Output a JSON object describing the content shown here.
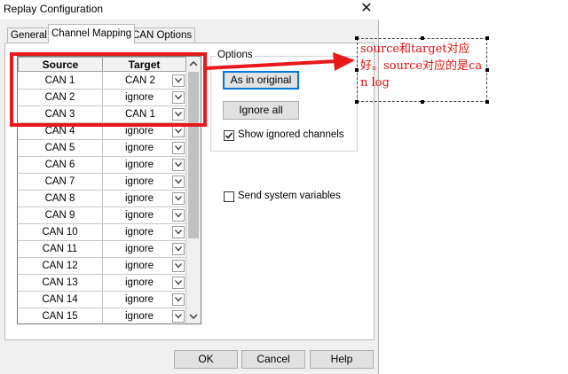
{
  "window": {
    "title": "Replay Configuration"
  },
  "tabs": [
    {
      "label": "General"
    },
    {
      "label": "Channel Mapping"
    },
    {
      "label": "CAN Options"
    }
  ],
  "grid": {
    "headers": {
      "source": "Source",
      "target": "Target"
    },
    "rows": [
      {
        "source": "CAN 1",
        "target": "CAN 2"
      },
      {
        "source": "CAN 2",
        "target": "ignore"
      },
      {
        "source": "CAN 3",
        "target": "CAN 1"
      },
      {
        "source": "CAN 4",
        "target": "ignore"
      },
      {
        "source": "CAN 5",
        "target": "ignore"
      },
      {
        "source": "CAN 6",
        "target": "ignore"
      },
      {
        "source": "CAN 7",
        "target": "ignore"
      },
      {
        "source": "CAN 8",
        "target": "ignore"
      },
      {
        "source": "CAN 9",
        "target": "ignore"
      },
      {
        "source": "CAN 10",
        "target": "ignore"
      },
      {
        "source": "CAN 11",
        "target": "ignore"
      },
      {
        "source": "CAN 12",
        "target": "ignore"
      },
      {
        "source": "CAN 13",
        "target": "ignore"
      },
      {
        "source": "CAN 14",
        "target": "ignore"
      },
      {
        "source": "CAN 15",
        "target": "ignore"
      }
    ]
  },
  "options": {
    "legend": "Options",
    "as_in_original": "As in original",
    "ignore_all": "Ignore all",
    "show_ignored": {
      "label": "Show ignored channels",
      "checked": true
    },
    "send_system_vars": {
      "label": "Send system variables",
      "checked": false
    }
  },
  "footer": {
    "ok": "OK",
    "cancel": "Cancel",
    "help": "Help"
  },
  "annotation": {
    "text": "source和target对应好。source对应的是can log"
  },
  "colors": {
    "highlight": "#e8191a",
    "annotation_text": "#e01010"
  }
}
